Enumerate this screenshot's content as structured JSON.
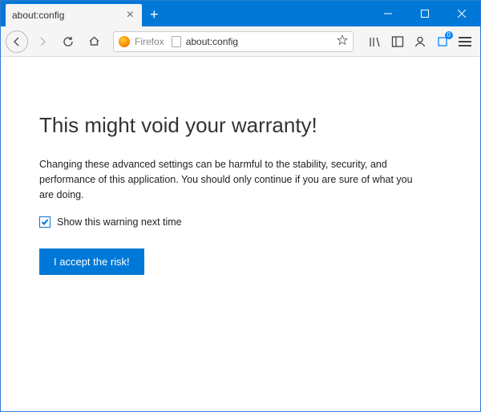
{
  "window": {
    "tab_title": "about:config",
    "newtab_tooltip": "+"
  },
  "urlbar": {
    "identity_label": "Firefox",
    "url": "about:config"
  },
  "extensions_badge": "0",
  "page": {
    "heading": "This might void your warranty!",
    "body": "Changing these advanced settings can be harmful to the stability, security, and performance of this application. You should only continue if you are sure of what you are doing.",
    "checkbox_label": "Show this warning next time",
    "accept_button": "I accept the risk!"
  }
}
